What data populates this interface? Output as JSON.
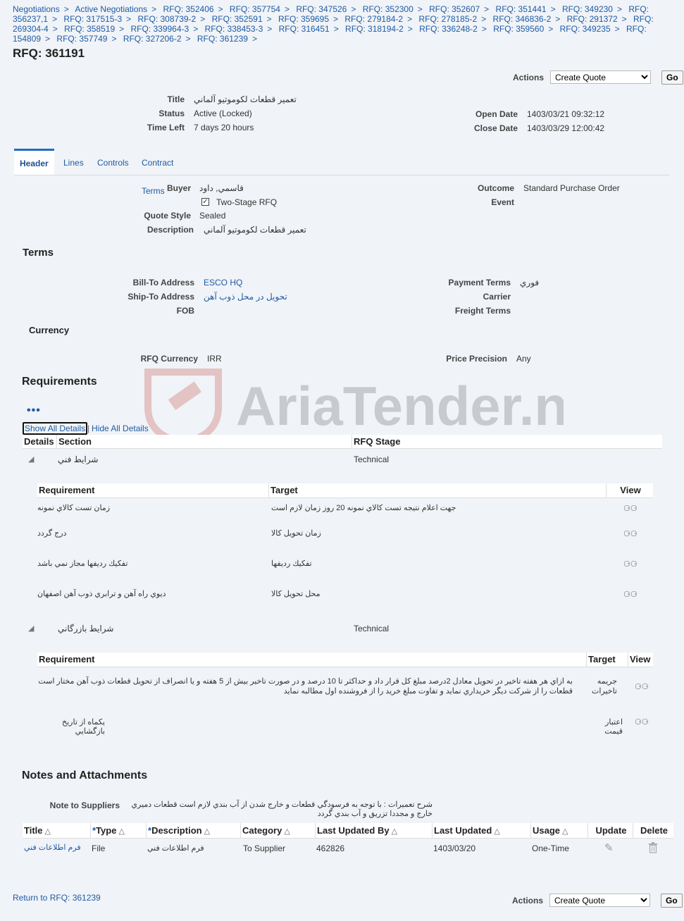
{
  "breadcrumbs": [
    "Negotiations",
    "Active Negotiations",
    "RFQ: 352406",
    "RFQ: 357754",
    "RFQ: 347526",
    "RFQ: 352300",
    "RFQ: 352607",
    "RFQ: 351441",
    "RFQ: 349230",
    "RFQ: 356237,1",
    "RFQ: 317515-3",
    "RFQ: 308739-2",
    "RFQ: 352591",
    "RFQ: 359695",
    "RFQ: 279184-2",
    "RFQ: 278185-2",
    "RFQ: 346836-2",
    "RFQ: 291372",
    "RFQ: 269304-4",
    "RFQ: 358519",
    "RFQ: 339964-3",
    "RFQ: 338453-3",
    "RFQ: 316451",
    "RFQ: 318194-2",
    "RFQ: 336248-2",
    "RFQ: 359560",
    "RFQ: 349235",
    "RFQ: 154809",
    "RFQ: 357749",
    "RFQ: 327206-2",
    "RFQ: 361239"
  ],
  "page_title": "RFQ: 361191",
  "actions": {
    "label": "Actions",
    "selected": "Create Quote",
    "go": "Go"
  },
  "summary": {
    "title_label": "Title",
    "title_value": "تعمير قطعات لكوموتيو آلماني",
    "status_label": "Status",
    "status_value": "Active (Locked)",
    "time_left_label": "Time Left",
    "time_left_value": "7 days 20 hours",
    "open_date_label": "Open Date",
    "open_date_value": "1403/03/21 09:32:12",
    "close_date_label": "Close Date",
    "close_date_value": "1403/03/29 12:00:42"
  },
  "tabs": [
    "Header",
    "Lines",
    "Controls",
    "Contract Terms"
  ],
  "header": {
    "buyer_label": "Buyer",
    "buyer_value": "قاسمي, داود",
    "two_stage_label": "Two-Stage RFQ",
    "quote_style_label": "Quote Style",
    "quote_style_value": "Sealed",
    "description_label": "Description",
    "description_value": "تعمير قطعات لكوموتيو آلماني",
    "outcome_label": "Outcome",
    "outcome_value": "Standard Purchase Order",
    "event_label": "Event"
  },
  "terms": {
    "heading": "Terms",
    "bill_to_label": "Bill-To Address",
    "bill_to_value": "ESCO HQ",
    "ship_to_label": "Ship-To Address",
    "ship_to_value": "تحويل در محل ذوب آهن",
    "fob_label": "FOB",
    "payment_terms_label": "Payment Terms",
    "payment_terms_value": "فوري",
    "carrier_label": "Carrier",
    "freight_terms_label": "Freight Terms"
  },
  "currency": {
    "heading": "Currency",
    "rfq_currency_label": "RFQ Currency",
    "rfq_currency_value": "IRR",
    "price_precision_label": "Price Precision",
    "price_precision_value": "Any"
  },
  "requirements": {
    "heading": "Requirements",
    "show_all": "Show All Details",
    "hide_all": "Hide All Details",
    "sep": "|",
    "col_details": "Details",
    "col_section": "Section",
    "col_stage": "RFQ Stage",
    "sections": [
      {
        "name": "شرايط فني",
        "stage": "Technical",
        "col_requirement": "Requirement",
        "col_target": "Target",
        "col_view": "View",
        "rows": [
          {
            "requirement": "زمان تست كالاي نمونه",
            "target": "جهت اعلام نتيجه تست كالاي نمونه 20 روز زمان لازم است"
          },
          {
            "requirement": "درج گردد",
            "target": "زمان تحويل كالا"
          },
          {
            "requirement": "تفكيك رديفها مجاز نمي باشد",
            "target": "تفكيك رديفها"
          },
          {
            "requirement": "ديوي راه آهن و ترابري ذوب آهن اصفهان",
            "target": "محل تحويل كالا"
          }
        ]
      },
      {
        "name": "شرايط بازرگاني",
        "stage": "Technical",
        "col_requirement": "Requirement",
        "col_target": "Target",
        "col_view": "View",
        "rows": [
          {
            "requirement": "به ازاي هر هفته تاخير در تحويل معادل 2درصد مبلغ كل قرار داد و حداكثر تا 10 درصد و در صورت تاخير بيش از 5 هفته و يا انصراف از تحويل قطعات ذوب آهن مختار است قطعات را از شركت ديگر خريداري نمايد و تفاوت مبلغ خريد را از فروشنده اول مطالبه نمايد",
            "target": "جريمه تاخيرات"
          },
          {
            "requirement": "يكماه از تاريخ بازگشايي",
            "target": "اعتبار قيمت"
          }
        ]
      }
    ]
  },
  "notes": {
    "heading": "Notes and Attachments",
    "note_label": "Note to Suppliers",
    "note_value": "شرح تعميرات : با توجه به فرسودگي قطعات و خارج شدن از آب بندي لازم است قطعات دميري خارج و مجددا تزريق و آب بندي گردد",
    "columns": [
      "Title",
      "Type",
      "Description",
      "Category",
      "Last Updated By",
      "Last Updated",
      "Usage",
      "Update",
      "Delete"
    ],
    "required_mark": "*",
    "row": {
      "title": "فرم اطلاعات فني",
      "type": "File",
      "description": "فرم اطلاعات فني",
      "category": "To Supplier",
      "updated_by": "462826",
      "updated": "1403/03/20",
      "usage": "One-Time"
    }
  },
  "footer": {
    "return_link": "Return to RFQ: 361239"
  },
  "watermark": "AriaTender.neT",
  "icons": {
    "view": "glasses-icon",
    "update": "pencil-icon",
    "delete": "trash-icon",
    "expand": "triangle-icon",
    "more": "ellipsis-icon"
  },
  "colors": {
    "link": "#1f5ba5",
    "background": "#f0f3f7",
    "tab_accent": "#1f6fbf"
  }
}
